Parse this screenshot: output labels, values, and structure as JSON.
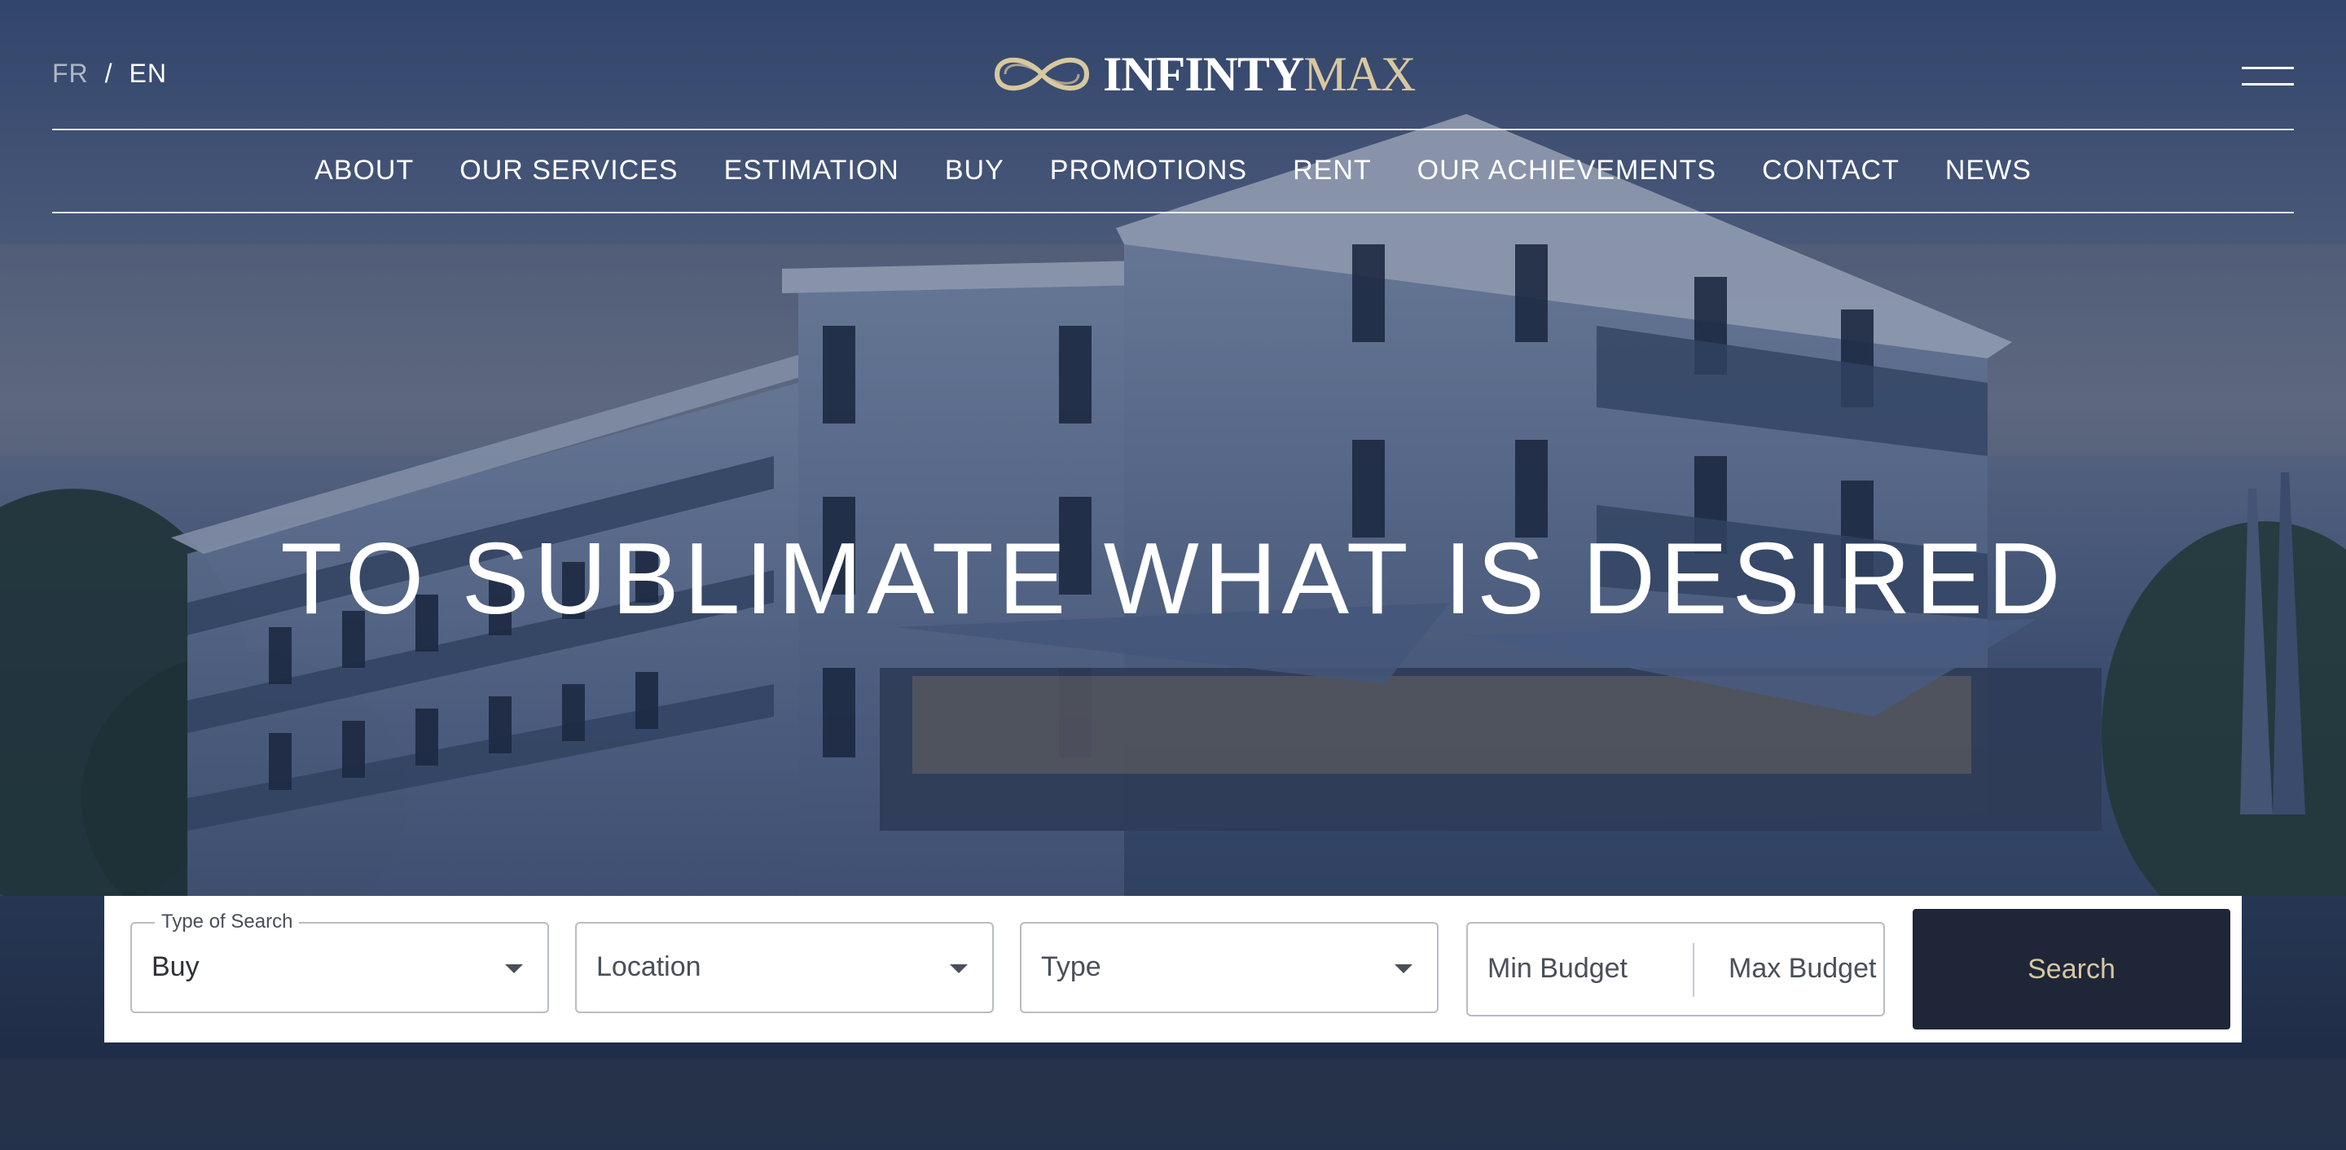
{
  "header": {
    "lang": {
      "fr": "FR",
      "separator": "/",
      "en": "EN"
    },
    "logo": {
      "word1": "INFINTY",
      "word2": "MAX"
    },
    "menu_icon": "hamburger-menu-icon"
  },
  "nav": {
    "items": [
      {
        "label": "ABOUT"
      },
      {
        "label": "OUR SERVICES"
      },
      {
        "label": "ESTIMATION"
      },
      {
        "label": "BUY"
      },
      {
        "label": "PROMOTIONS"
      },
      {
        "label": "RENT"
      },
      {
        "label": "OUR ACHIEVEMENTS"
      },
      {
        "label": "CONTACT"
      },
      {
        "label": "NEWS"
      }
    ]
  },
  "hero": {
    "headline": "TO SUBLIMATE WHAT IS DESIRED"
  },
  "search": {
    "type_of_search": {
      "legend": "Type of Search",
      "value": "Buy"
    },
    "location": {
      "placeholder": "Location"
    },
    "type": {
      "placeholder": "Type"
    },
    "budget": {
      "min_placeholder": "Min Budget",
      "max_placeholder": "Max Budget"
    },
    "button_label": "Search"
  },
  "colors": {
    "accent_gold": "#d6c7a1",
    "button_bg": "#1e2638"
  }
}
